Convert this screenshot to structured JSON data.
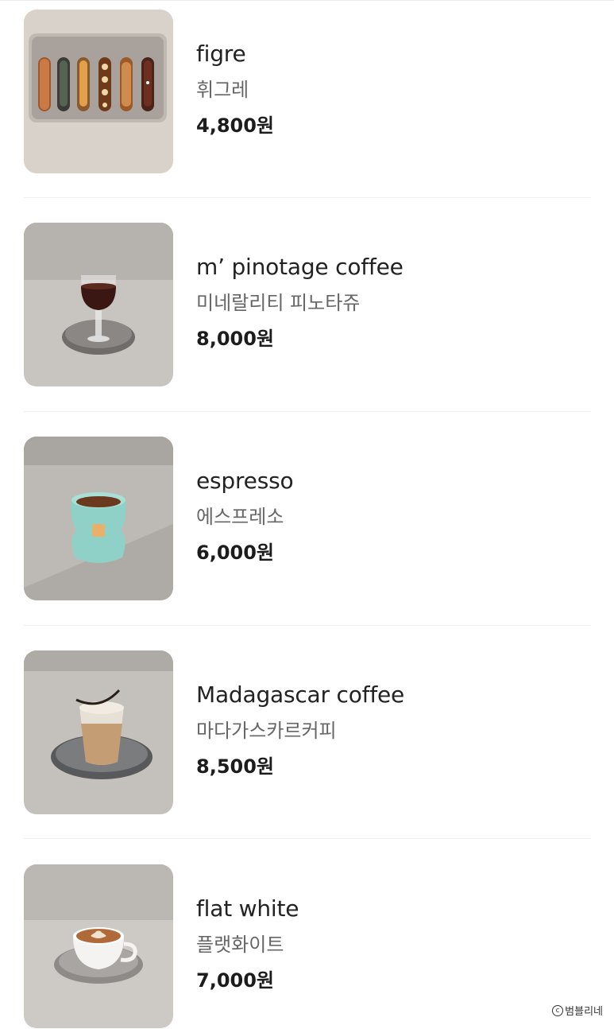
{
  "menu": {
    "items": [
      {
        "name_en": "figre",
        "name_ko": "휘그레",
        "price": "4,800원",
        "image": "figre-tray-photo"
      },
      {
        "name_en": "m’ pinotage coffee",
        "name_ko": "미네랄리티 피노타쥬",
        "price": "8,000원",
        "image": "wine-glass-coffee-photo"
      },
      {
        "name_en": "espresso",
        "name_ko": "에스프레소",
        "price": "6,000원",
        "image": "mint-cup-espresso-photo"
      },
      {
        "name_en": "Madagascar coffee",
        "name_ko": "마다가스카르커피",
        "price": "8,500원",
        "image": "iced-glass-coffee-photo"
      },
      {
        "name_en": "flat white",
        "name_ko": "플랫화이트",
        "price": "7,000원",
        "image": "latte-art-cup-photo"
      }
    ]
  },
  "footer": {
    "copyright_icon": "copyright-icon",
    "copyright_text": "범블리네"
  },
  "colors": {
    "background": "#ffffff",
    "divider": "#efefef",
    "name": "#222222",
    "subtitle": "#666666",
    "price": "#1c1c1c"
  }
}
